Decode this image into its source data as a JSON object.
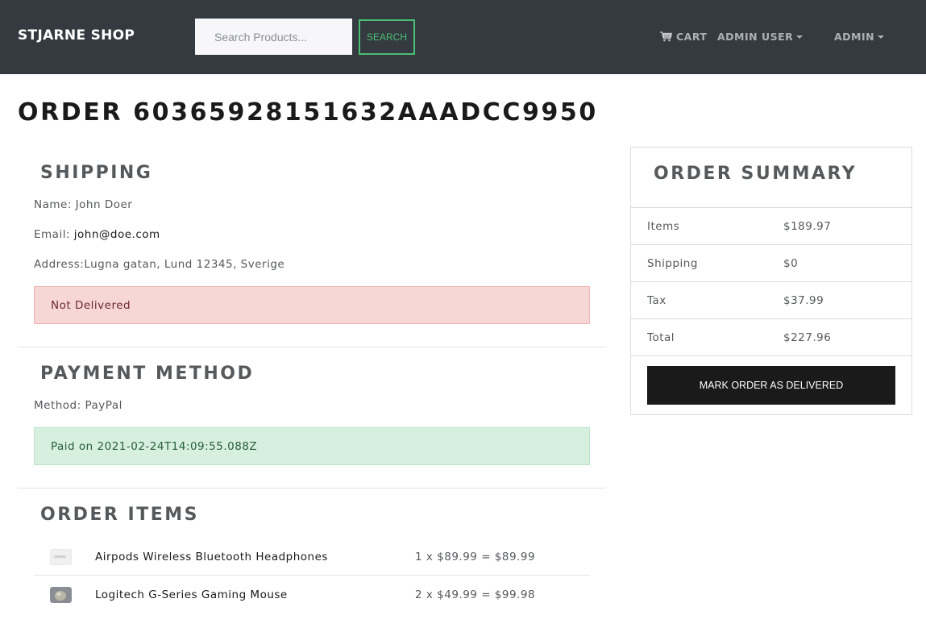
{
  "navbar": {
    "brand": "STJARNE SHOP",
    "search_placeholder": "Search Products...",
    "search_button": "SEARCH",
    "cart_label": "CART",
    "user_menu": "ADMIN USER",
    "admin_menu": "ADMIN"
  },
  "order": {
    "title": "ORDER 60365928151632AAADCC9950"
  },
  "shipping": {
    "heading": "SHIPPING",
    "name_label": "Name: ",
    "name": "John Doer",
    "email_label": "Email: ",
    "email": "john@doe.com",
    "address_label": "Address:",
    "address": "Lugna gatan, Lund 12345, Sverige",
    "status": "Not Delivered"
  },
  "payment": {
    "heading": "PAYMENT METHOD",
    "method_label": "Method: ",
    "method": "PayPal",
    "status": "Paid on 2021-02-24T14:09:55.088Z"
  },
  "items": {
    "heading": "ORDER ITEMS",
    "list": [
      {
        "name": "Airpods Wireless Bluetooth Headphones",
        "price": "1 x $89.99 = $89.99"
      },
      {
        "name": "Logitech G-Series Gaming Mouse",
        "price": "2 x $49.99 = $99.98"
      }
    ]
  },
  "summary": {
    "heading": "ORDER SUMMARY",
    "rows": [
      {
        "label": "Items",
        "value": "$189.97"
      },
      {
        "label": "Shipping",
        "value": "$0"
      },
      {
        "label": "Tax",
        "value": "$37.99"
      },
      {
        "label": "Total",
        "value": "$227.96"
      }
    ],
    "deliver_button": "MARK ORDER AS DELIVERED"
  },
  "colors": {
    "navbar": "#343a40",
    "accent": "#4bbf73",
    "danger_bg": "#f7d6d6",
    "success_bg": "#d7efdf",
    "dark_button": "#1a1a1a"
  },
  "icons": {
    "cart": "cart-icon",
    "dropdown": "caret-down-icon"
  }
}
